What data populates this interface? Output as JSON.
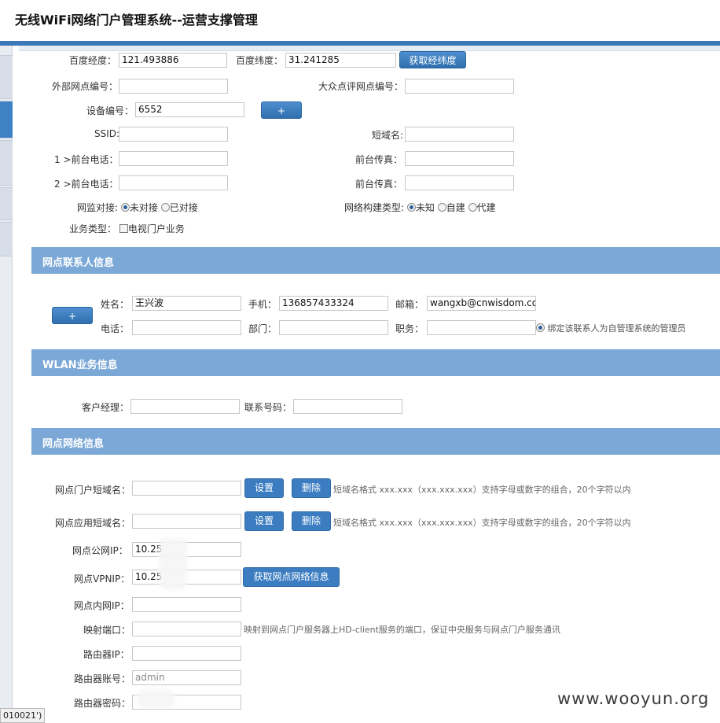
{
  "header": {
    "title": "无线WiFi网络门户管理系统--运营支撑管理"
  },
  "basic": {
    "baidu_lng_label": "百度经度：",
    "baidu_lng": "121.493886",
    "baidu_lat_label": "百度纬度：",
    "baidu_lat": "31.241285",
    "get_coords_button": "获取经纬度",
    "ext_site_no_label": "外部网点编号：",
    "ext_site_no": "",
    "dianping_no_label": "大众点评网点编号：",
    "dianping_no": "",
    "device_no_label": "设备编号：",
    "device_no": "6552",
    "add_button": "+",
    "ssid_label": "SSID:",
    "ssid": "",
    "short_domain_label": "短域名:",
    "short_domain": "",
    "phone1_label": "1 >前台电话：",
    "phone1": "",
    "fax1_label": "前台传真：",
    "fax1": "",
    "phone2_label": "2 >前台电话：",
    "phone2": "",
    "fax2_label": "前台传真：",
    "fax2": "",
    "monitor_label": "网监对接:",
    "monitor_options": [
      "未对接",
      "已对接"
    ],
    "network_type_label": "网络构建类型:",
    "network_type_options": [
      "未知",
      "自建",
      "代建"
    ],
    "business_type_label": "业务类型：",
    "business_type_option": "电视门户业务"
  },
  "contact": {
    "section_title": "网点联系人信息",
    "add_button": "+",
    "name_label": "姓名：",
    "name": "王兴波",
    "mobile_label": "手机：",
    "mobile": "136857433324",
    "email_label": "邮箱：",
    "email": "wangxb@cnwisdom.com",
    "tel_label": "电话：",
    "tel": "",
    "dept_label": "部门：",
    "dept": "",
    "title_label": "职务：",
    "title": "",
    "bind_admin_text": "绑定该联系人为自管理系统的管理员"
  },
  "wlan": {
    "section_title": "WLAN业务信息",
    "manager_label": "客户经理：",
    "manager": "",
    "contact_no_label": "联系号码：",
    "contact_no": ""
  },
  "network": {
    "section_title": "网点网络信息",
    "portal_domain_label": "网点门户短域名：",
    "portal_domain": "",
    "app_domain_label": "网点应用短域名：",
    "app_domain": "",
    "set_button": "设置",
    "delete_button": "删除",
    "domain_hint": "短域名格式 xxx.xxx（xxx.xxx.xxx）支持字母或数字的组合，20个字符以内",
    "public_ip_label": "网点公网IP：",
    "public_ip": "10.25",
    "vpn_ip_label": "网点VPNIP：",
    "vpn_ip": "10.25",
    "get_network_button": "获取网点网络信息",
    "lan_ip_label": "网点内网IP：",
    "lan_ip": "",
    "mapped_port_label": "映射端口：",
    "mapped_port": "",
    "mapped_port_hint": "映射到网点门户服务器上HD-client服务的端口，保证中央服务与网点门户服务通讯",
    "router_ip_label": "路由器IP：",
    "router_ip": "",
    "router_account_label": "路由器账号：",
    "router_account": "admin",
    "router_password_label": "路由器密码：",
    "router_password": ""
  },
  "status_bar": {
    "text": "010021')"
  },
  "watermark": "www.wooyun.org"
}
